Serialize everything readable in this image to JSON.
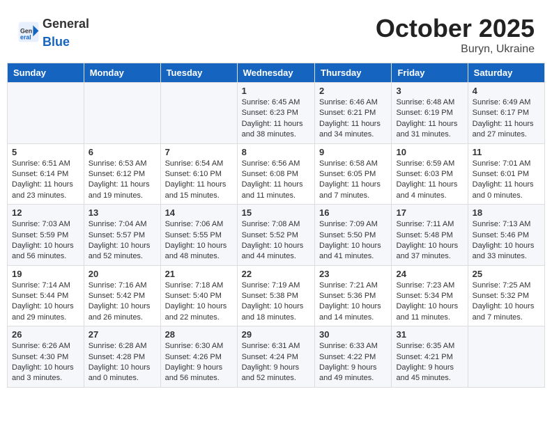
{
  "header": {
    "logo_general": "General",
    "logo_blue": "Blue",
    "month_title": "October 2025",
    "location": "Buryn, Ukraine"
  },
  "weekdays": [
    "Sunday",
    "Monday",
    "Tuesday",
    "Wednesday",
    "Thursday",
    "Friday",
    "Saturday"
  ],
  "weeks": [
    [
      {
        "day": "",
        "sunrise": "",
        "sunset": "",
        "daylight": ""
      },
      {
        "day": "",
        "sunrise": "",
        "sunset": "",
        "daylight": ""
      },
      {
        "day": "",
        "sunrise": "",
        "sunset": "",
        "daylight": ""
      },
      {
        "day": "1",
        "sunrise": "Sunrise: 6:45 AM",
        "sunset": "Sunset: 6:23 PM",
        "daylight": "Daylight: 11 hours and 38 minutes."
      },
      {
        "day": "2",
        "sunrise": "Sunrise: 6:46 AM",
        "sunset": "Sunset: 6:21 PM",
        "daylight": "Daylight: 11 hours and 34 minutes."
      },
      {
        "day": "3",
        "sunrise": "Sunrise: 6:48 AM",
        "sunset": "Sunset: 6:19 PM",
        "daylight": "Daylight: 11 hours and 31 minutes."
      },
      {
        "day": "4",
        "sunrise": "Sunrise: 6:49 AM",
        "sunset": "Sunset: 6:17 PM",
        "daylight": "Daylight: 11 hours and 27 minutes."
      }
    ],
    [
      {
        "day": "5",
        "sunrise": "Sunrise: 6:51 AM",
        "sunset": "Sunset: 6:14 PM",
        "daylight": "Daylight: 11 hours and 23 minutes."
      },
      {
        "day": "6",
        "sunrise": "Sunrise: 6:53 AM",
        "sunset": "Sunset: 6:12 PM",
        "daylight": "Daylight: 11 hours and 19 minutes."
      },
      {
        "day": "7",
        "sunrise": "Sunrise: 6:54 AM",
        "sunset": "Sunset: 6:10 PM",
        "daylight": "Daylight: 11 hours and 15 minutes."
      },
      {
        "day": "8",
        "sunrise": "Sunrise: 6:56 AM",
        "sunset": "Sunset: 6:08 PM",
        "daylight": "Daylight: 11 hours and 11 minutes."
      },
      {
        "day": "9",
        "sunrise": "Sunrise: 6:58 AM",
        "sunset": "Sunset: 6:05 PM",
        "daylight": "Daylight: 11 hours and 7 minutes."
      },
      {
        "day": "10",
        "sunrise": "Sunrise: 6:59 AM",
        "sunset": "Sunset: 6:03 PM",
        "daylight": "Daylight: 11 hours and 4 minutes."
      },
      {
        "day": "11",
        "sunrise": "Sunrise: 7:01 AM",
        "sunset": "Sunset: 6:01 PM",
        "daylight": "Daylight: 11 hours and 0 minutes."
      }
    ],
    [
      {
        "day": "12",
        "sunrise": "Sunrise: 7:03 AM",
        "sunset": "Sunset: 5:59 PM",
        "daylight": "Daylight: 10 hours and 56 minutes."
      },
      {
        "day": "13",
        "sunrise": "Sunrise: 7:04 AM",
        "sunset": "Sunset: 5:57 PM",
        "daylight": "Daylight: 10 hours and 52 minutes."
      },
      {
        "day": "14",
        "sunrise": "Sunrise: 7:06 AM",
        "sunset": "Sunset: 5:55 PM",
        "daylight": "Daylight: 10 hours and 48 minutes."
      },
      {
        "day": "15",
        "sunrise": "Sunrise: 7:08 AM",
        "sunset": "Sunset: 5:52 PM",
        "daylight": "Daylight: 10 hours and 44 minutes."
      },
      {
        "day": "16",
        "sunrise": "Sunrise: 7:09 AM",
        "sunset": "Sunset: 5:50 PM",
        "daylight": "Daylight: 10 hours and 41 minutes."
      },
      {
        "day": "17",
        "sunrise": "Sunrise: 7:11 AM",
        "sunset": "Sunset: 5:48 PM",
        "daylight": "Daylight: 10 hours and 37 minutes."
      },
      {
        "day": "18",
        "sunrise": "Sunrise: 7:13 AM",
        "sunset": "Sunset: 5:46 PM",
        "daylight": "Daylight: 10 hours and 33 minutes."
      }
    ],
    [
      {
        "day": "19",
        "sunrise": "Sunrise: 7:14 AM",
        "sunset": "Sunset: 5:44 PM",
        "daylight": "Daylight: 10 hours and 29 minutes."
      },
      {
        "day": "20",
        "sunrise": "Sunrise: 7:16 AM",
        "sunset": "Sunset: 5:42 PM",
        "daylight": "Daylight: 10 hours and 26 minutes."
      },
      {
        "day": "21",
        "sunrise": "Sunrise: 7:18 AM",
        "sunset": "Sunset: 5:40 PM",
        "daylight": "Daylight: 10 hours and 22 minutes."
      },
      {
        "day": "22",
        "sunrise": "Sunrise: 7:19 AM",
        "sunset": "Sunset: 5:38 PM",
        "daylight": "Daylight: 10 hours and 18 minutes."
      },
      {
        "day": "23",
        "sunrise": "Sunrise: 7:21 AM",
        "sunset": "Sunset: 5:36 PM",
        "daylight": "Daylight: 10 hours and 14 minutes."
      },
      {
        "day": "24",
        "sunrise": "Sunrise: 7:23 AM",
        "sunset": "Sunset: 5:34 PM",
        "daylight": "Daylight: 10 hours and 11 minutes."
      },
      {
        "day": "25",
        "sunrise": "Sunrise: 7:25 AM",
        "sunset": "Sunset: 5:32 PM",
        "daylight": "Daylight: 10 hours and 7 minutes."
      }
    ],
    [
      {
        "day": "26",
        "sunrise": "Sunrise: 6:26 AM",
        "sunset": "Sunset: 4:30 PM",
        "daylight": "Daylight: 10 hours and 3 minutes."
      },
      {
        "day": "27",
        "sunrise": "Sunrise: 6:28 AM",
        "sunset": "Sunset: 4:28 PM",
        "daylight": "Daylight: 10 hours and 0 minutes."
      },
      {
        "day": "28",
        "sunrise": "Sunrise: 6:30 AM",
        "sunset": "Sunset: 4:26 PM",
        "daylight": "Daylight: 9 hours and 56 minutes."
      },
      {
        "day": "29",
        "sunrise": "Sunrise: 6:31 AM",
        "sunset": "Sunset: 4:24 PM",
        "daylight": "Daylight: 9 hours and 52 minutes."
      },
      {
        "day": "30",
        "sunrise": "Sunrise: 6:33 AM",
        "sunset": "Sunset: 4:22 PM",
        "daylight": "Daylight: 9 hours and 49 minutes."
      },
      {
        "day": "31",
        "sunrise": "Sunrise: 6:35 AM",
        "sunset": "Sunset: 4:21 PM",
        "daylight": "Daylight: 9 hours and 45 minutes."
      },
      {
        "day": "",
        "sunrise": "",
        "sunset": "",
        "daylight": ""
      }
    ]
  ]
}
